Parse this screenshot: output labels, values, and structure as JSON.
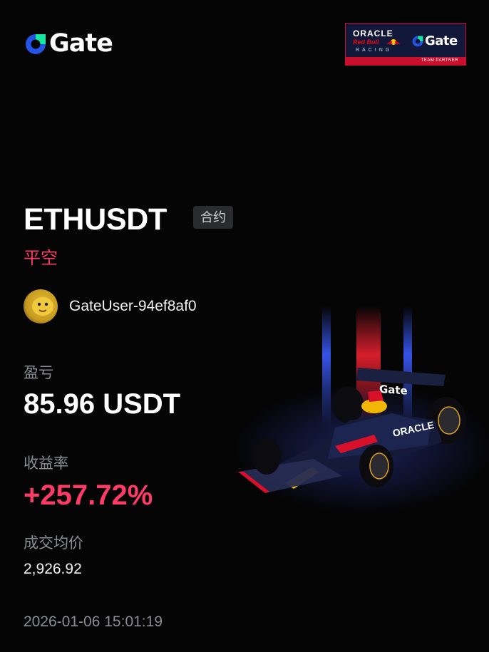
{
  "brand": {
    "logo_text": "Gate"
  },
  "partner_badge": {
    "oracle_text": "ORACLE",
    "redbull_text": "Red Bull",
    "racing_text": "RACING",
    "gate_text": "Gate",
    "strip_text": "TEAM PARTNER"
  },
  "trade": {
    "symbol": "ETHUSDT",
    "type_tag": "合约",
    "direction": "平空"
  },
  "user": {
    "name": "GateUser-94ef8af0"
  },
  "stats": {
    "pnl_label": "盈亏",
    "pnl_value": "85.96 USDT",
    "roi_label": "收益率",
    "roi_value": "+257.72%",
    "avg_price_label": "成交均价",
    "avg_price_value": "2,926.92"
  },
  "timestamp": "2026-01-06 15:01:19",
  "car_livery": {
    "wing_text": "Gate",
    "sidepod_text": "ORACLE"
  },
  "colors": {
    "accent_red": "#fe3b66",
    "gate_blue": "#2354e6",
    "gate_green": "#17e6a1",
    "muted": "#8b8d93"
  }
}
